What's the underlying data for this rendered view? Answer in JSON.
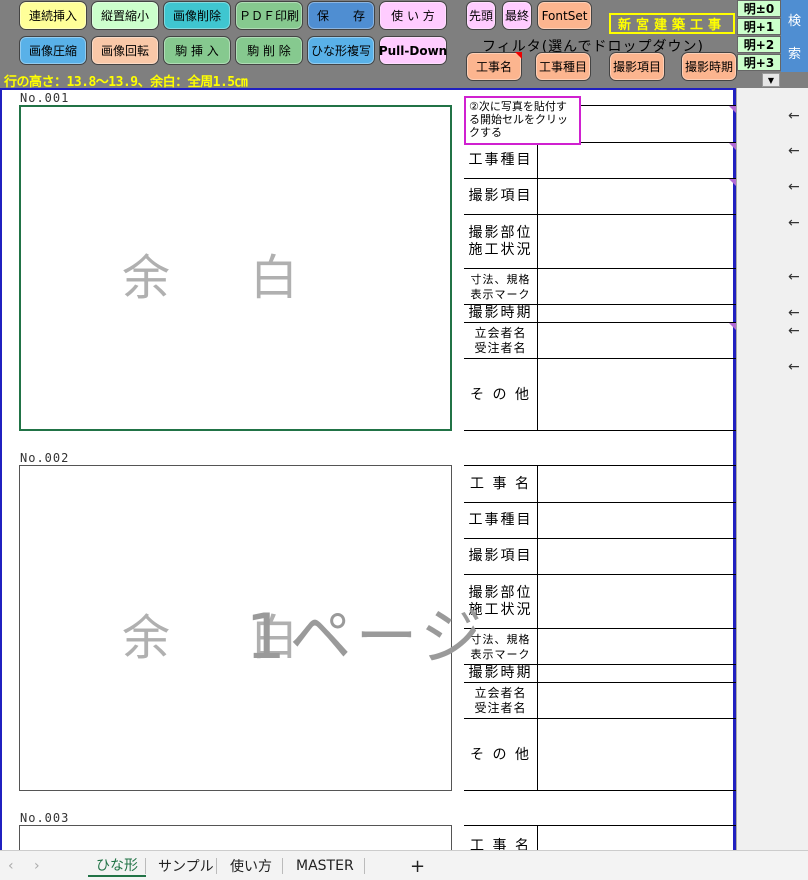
{
  "toolbar": {
    "row1": [
      "連続挿入",
      "縦置縮小",
      "画像削除",
      "ＰＤＦ印刷",
      "保　　存",
      "使 い 方"
    ],
    "row2": [
      "画像圧縮",
      "画像回転",
      "駒 挿 入",
      "駒 削 除",
      "ひな形複写",
      "Pull-Down"
    ],
    "small": [
      "先頭",
      "最終",
      "FontSet"
    ],
    "filter_btns": [
      "工事名",
      "工事種目",
      "撮影項目",
      "撮影時期"
    ],
    "kuni": "新宮建築工事",
    "mei": [
      "明±0",
      "明+1",
      "明+2",
      "明+3"
    ],
    "search": [
      "検",
      "索"
    ],
    "filter_label": "フィルタ(選んでドロップダウン)",
    "row_height": "行の高さ：13.8～13.9、余白：全周1.5㎝",
    "dropdown_icon": "chevron-down-icon"
  },
  "records": [
    {
      "no": "No.001",
      "yohaku": "余白"
    },
    {
      "no": "No.002",
      "yohaku": "余白"
    },
    {
      "no": "No.003"
    }
  ],
  "labels": {
    "koji": "工 事 名",
    "shumoku": "工事種目",
    "komoku": "撮影項目",
    "bui1": "撮影部位",
    "bui2": "施工状況",
    "sunpo1": "寸法、規格",
    "sunpo2": "表示マーク",
    "jiki": "撮影時期",
    "tachiai1": "立会者名",
    "tachiai2": "受注者名",
    "sonota": "そ の 他"
  },
  "comment": "②次に写真を貼付する開始セルをクリックする",
  "watermark": "1ページ",
  "arrows": [
    "←",
    "←",
    "←",
    "←",
    "←",
    "←",
    "←",
    "←"
  ],
  "tabs": {
    "nav": [
      "‹",
      "›"
    ],
    "items": [
      "ひな形",
      "サンプル",
      "使い方",
      "MASTER"
    ],
    "add": "+"
  }
}
